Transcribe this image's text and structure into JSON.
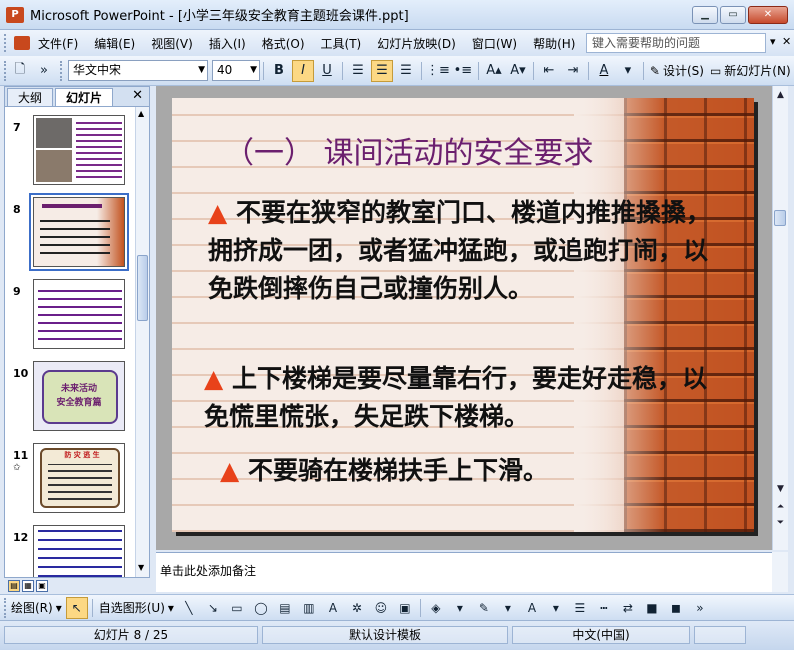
{
  "window": {
    "app_icon_text": "P",
    "title": "Microsoft PowerPoint - [小学三年级安全教育主题班会课件.ppt]",
    "min_icon": "▁",
    "max_icon": "▭",
    "close_icon": "✕"
  },
  "menu": {
    "items": [
      "文件(F)",
      "编辑(E)",
      "视图(V)",
      "插入(I)",
      "格式(O)",
      "工具(T)",
      "幻灯片放映(D)",
      "窗口(W)",
      "帮助(H)"
    ],
    "help_placeholder": "键入需要帮助的问题",
    "close_icon": "✕"
  },
  "toolbar": {
    "font": "华文中宋",
    "size": "40",
    "bold": "B",
    "italic": "I",
    "underline": "U",
    "design_label": "设计(S)",
    "new_slide_label": "新幻灯片(N)"
  },
  "leftpane": {
    "tabs": [
      "大纲",
      "幻灯片"
    ],
    "close_icon": "✕",
    "slide_numbers": [
      "7",
      "8",
      "9",
      "10",
      "11",
      "12"
    ],
    "thumb10_text": "未来活动\n安全教育篇",
    "thumb11_text": "防 灾 逃 生"
  },
  "slide": {
    "title": "（一）  课间活动的安全要求",
    "bullet_symbol": "▲",
    "para1": "  不要在狭窄的教室门口、楼道内推推搡搡，拥挤成一团，或者猛冲猛跑，或追跑打闹，以免跌倒摔伤自己或撞伤别人。",
    "para2": " 上下楼梯是要尽量靠右行，要走好走稳，以免慌里慌张，失足跌下楼梯。",
    "para3": " 不要骑在楼梯扶手上下滑。"
  },
  "notes": {
    "placeholder": "单击此处添加备注"
  },
  "drawbar": {
    "draw_label": "绘图(R)",
    "autoshape_label": "自选图形(U)"
  },
  "status": {
    "slide_info": "幻灯片 8 / 25",
    "template": "默认设计模板",
    "language": "中文(中国)"
  },
  "colors": {
    "title_color": "#6b1f6e",
    "bullet_color": "#e8421a",
    "selection": "#3c6ec8"
  }
}
